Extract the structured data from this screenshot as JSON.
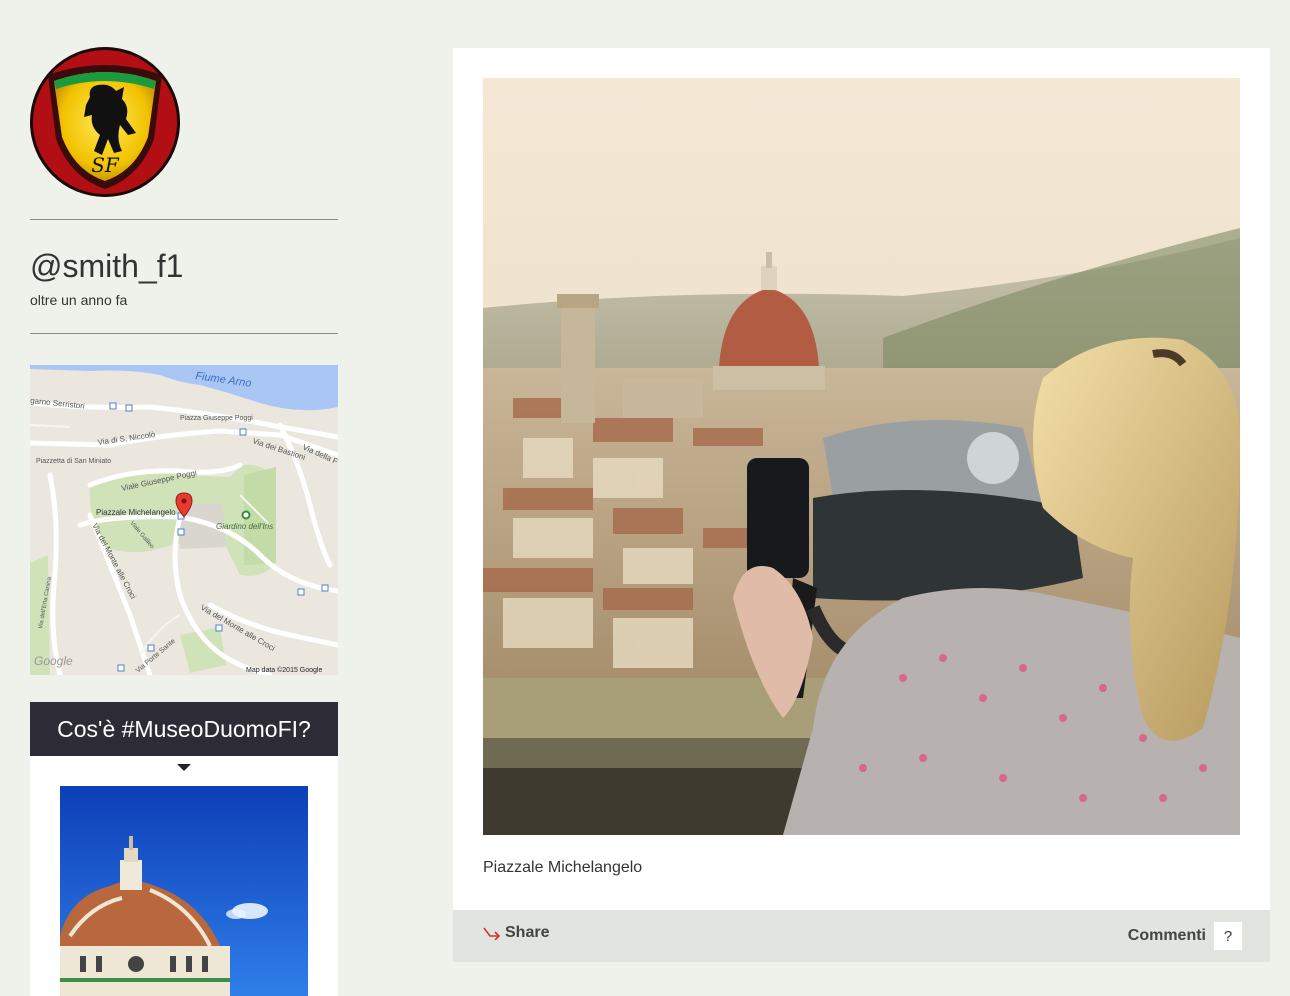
{
  "profile": {
    "username": "@smith_f1",
    "time_ago": "oltre un anno fa",
    "avatar_icon": "ferrari-shield-logo"
  },
  "map": {
    "labels": {
      "river": "Fiume Arno",
      "lungarno": "garno Serristori",
      "piazza_poggi": "Piazza Giuseppe Poggi",
      "via_niccolo": "Via di S. Niccolò",
      "via_bastioni": "Via dei Bastioni",
      "via_della": "Via della F",
      "san_miniato": "Piazzetta di San Miniato",
      "viale_poggi": "Viale Giuseppe Poggi",
      "piazzale": "Piazzale Michelangelo",
      "giardino": "Giardino dell'Iris",
      "monte_croci": "Via del Monte alle Croci",
      "viale_galileo": "Viale Galileo",
      "erta": "Via dell'Erta Canina",
      "porte_sante": "Via Porte Sante",
      "monte_croci_2": "Via del Monte alle Croci",
      "google": "Google",
      "attribution": "Map data ©2015 Google"
    },
    "pin_icon": "map-pin-icon"
  },
  "promo": {
    "title": "Cos'è #MuseoDuomoFI?",
    "arrow_icon": "triangle-down-icon"
  },
  "post": {
    "caption": "Piazzale Michelangelo",
    "share_label": "Share",
    "share_icon": "share-arrow-icon",
    "comments_label": "Commenti",
    "comments_count": "?"
  },
  "colors": {
    "page_bg": "#eef2ea",
    "promo_header": "#2d2c36",
    "footer_bg": "#e1e4df",
    "share_arrow": "#d0342c"
  }
}
